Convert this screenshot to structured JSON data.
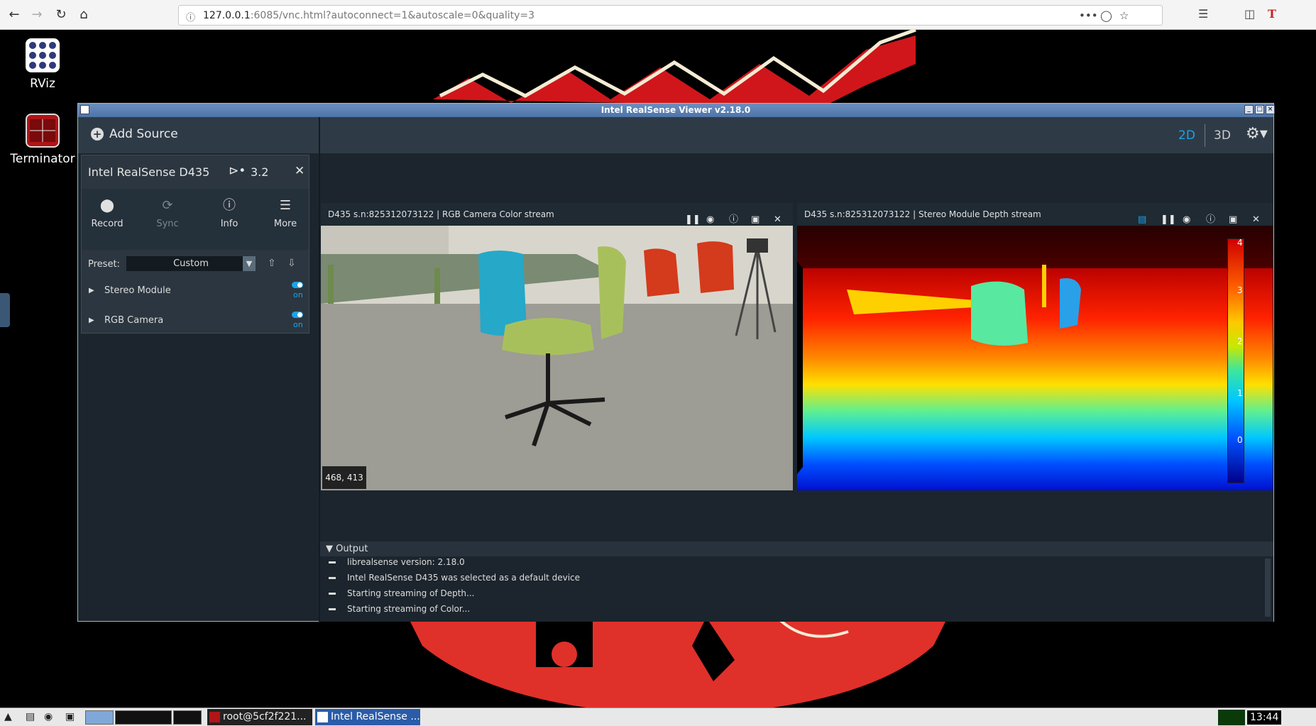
{
  "browser": {
    "url_host": "127.0.0.1",
    "url_rest": ":6085/vnc.html?autoconnect=1&autoscale=0&quality=3",
    "menu_dots": "•••",
    "tb_letter": "T"
  },
  "desktop": {
    "icons": [
      {
        "label": "RViz"
      },
      {
        "label": "Terminator"
      }
    ]
  },
  "window": {
    "title": "Intel RealSense Viewer v2.18.0",
    "add_source": "Add Source",
    "view_2d": "2D",
    "view_3d": "3D",
    "device": {
      "name": "Intel RealSense D435",
      "usb": "3.2",
      "actions": [
        {
          "label": "Record",
          "icon": "record-icon"
        },
        {
          "label": "Sync",
          "icon": "sync-icon"
        },
        {
          "label": "Info",
          "icon": "info-icon"
        },
        {
          "label": "More",
          "icon": "menu-icon"
        }
      ],
      "preset_label": "Preset:",
      "preset_value": "Custom",
      "modules": [
        {
          "label": "Stereo Module",
          "state": "on"
        },
        {
          "label": "RGB Camera",
          "state": "on"
        }
      ]
    },
    "streams": [
      {
        "title": "D435 s.n:825312073122 | RGB Camera Color stream",
        "coords": "468, 413"
      },
      {
        "title": "D435 s.n:825312073122 | Stereo Module Depth stream",
        "colorbar_labels": [
          "4",
          "3",
          "2",
          "1",
          "0"
        ]
      }
    ],
    "output": {
      "title": "Output",
      "lines": [
        "librealsense version: 2.18.0",
        "Intel RealSense D435 was selected as a default device",
        "Starting streaming of Depth...",
        "Starting streaming of Color..."
      ]
    }
  },
  "taskbar": {
    "tasks": [
      {
        "label": "root@5cf2f221..."
      },
      {
        "label": "Intel RealSense ..."
      }
    ],
    "clock": "13:44"
  },
  "colors": {
    "accent": "#1ba3e8",
    "panel": "#2b3640",
    "window_bg": "#1c252d"
  }
}
